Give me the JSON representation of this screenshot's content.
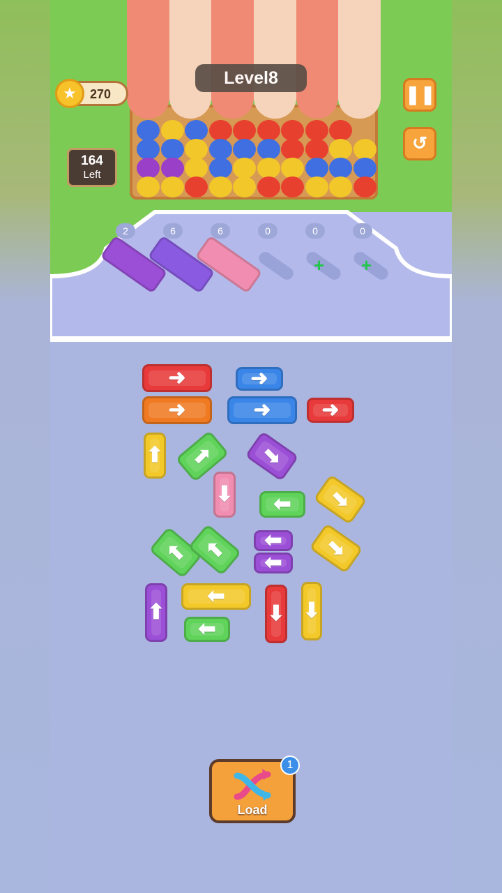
{
  "hud": {
    "coins": "270",
    "level": "Level8",
    "remaining_count": "164",
    "remaining_label": "Left"
  },
  "icons": {
    "coin": "star-coin-icon",
    "pause": "pause-icon",
    "undo": "undo-icon",
    "load": "shuffle-icon"
  },
  "dock_slots": [
    {
      "count": "2",
      "truck_color": "#9b4fd6",
      "filled": true
    },
    {
      "count": "6",
      "truck_color": "#8a5be0",
      "filled": true
    },
    {
      "count": "6",
      "truck_color": "#f08db0",
      "filled": true
    },
    {
      "count": "0",
      "filled": false,
      "locked": false
    },
    {
      "count": "0",
      "filled": false,
      "locked": true
    },
    {
      "count": "0",
      "filled": false,
      "locked": true
    }
  ],
  "parking_trucks": [
    {
      "color": "#e83a3a",
      "direction": "right"
    },
    {
      "color": "#3a86e8",
      "direction": "right"
    },
    {
      "color": "#f07a22",
      "direction": "right"
    },
    {
      "color": "#3a86e8",
      "direction": "right"
    },
    {
      "color": "#e83a3a",
      "direction": "right"
    },
    {
      "color": "#f3c92a",
      "direction": "up"
    },
    {
      "color": "#5fd35a",
      "direction": "up-right"
    },
    {
      "color": "#9b4fd6",
      "direction": "down-right"
    },
    {
      "color": "#f08db0",
      "direction": "down"
    },
    {
      "color": "#5fd35a",
      "direction": "left"
    },
    {
      "color": "#f3c92a",
      "direction": "down-right"
    },
    {
      "color": "#5fd35a",
      "direction": "up-left"
    },
    {
      "color": "#5fd35a",
      "direction": "up-left"
    },
    {
      "color": "#9b4fd6",
      "direction": "left"
    },
    {
      "color": "#9b4fd6",
      "direction": "left"
    },
    {
      "color": "#f3c92a",
      "direction": "down-right"
    },
    {
      "color": "#9b4fd6",
      "direction": "up"
    },
    {
      "color": "#f3c92a",
      "direction": "left"
    },
    {
      "color": "#5fd35a",
      "direction": "left"
    },
    {
      "color": "#e83a3a",
      "direction": "down"
    },
    {
      "color": "#f3c92a",
      "direction": "down"
    }
  ],
  "load_button": {
    "label": "Load",
    "badge": "1"
  },
  "colors": {
    "grass": "#7ccb54",
    "dock": "#b3b9ea",
    "road": "#aab6e0",
    "button_orange": "#f7a43d"
  }
}
